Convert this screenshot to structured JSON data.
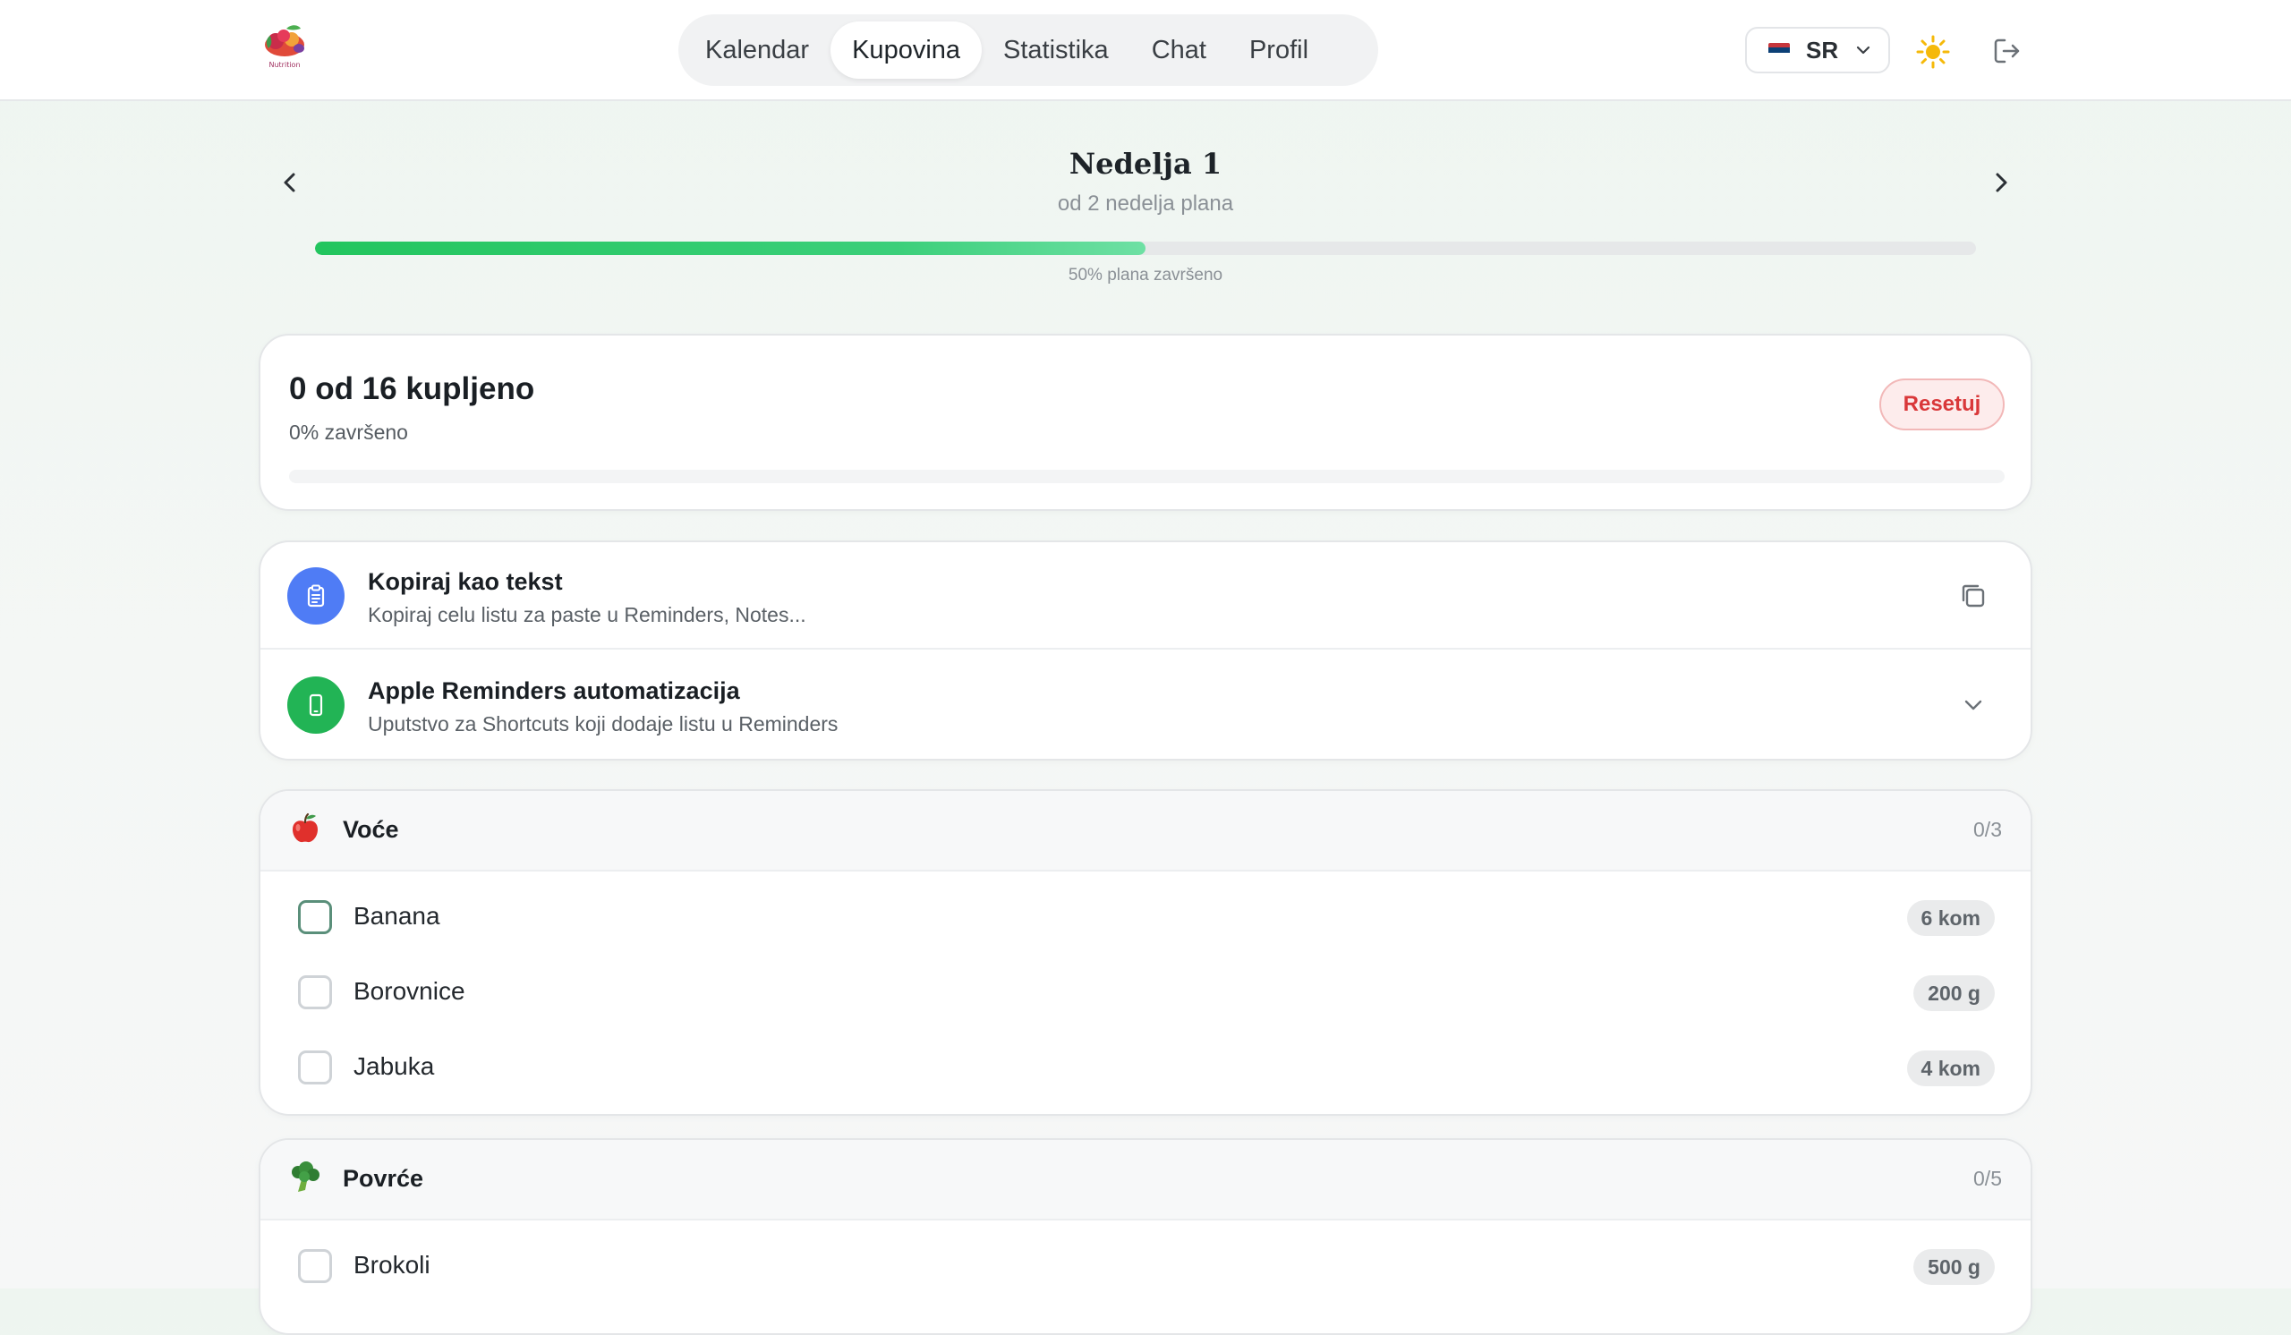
{
  "brand": {
    "logo_text": "Nutrition"
  },
  "nav": {
    "tabs": [
      {
        "label": "Kalendar",
        "active": false
      },
      {
        "label": "Kupovina",
        "active": true
      },
      {
        "label": "Statistika",
        "active": false
      },
      {
        "label": "Chat",
        "active": false
      },
      {
        "label": "Profil",
        "active": false
      }
    ]
  },
  "language": {
    "code": "SR",
    "flag_colors": [
      "#c6363c",
      "#0c4076",
      "#ffffff"
    ]
  },
  "icons": {
    "theme": "sun-icon",
    "logout": "logout-icon",
    "prev": "chevron-left-icon",
    "next": "chevron-right-icon"
  },
  "week": {
    "title": "Nedelja 1",
    "subtitle": "od 2 nedelja plana",
    "plan_progress_percent": 50,
    "plan_progress_label": "50% plana završeno"
  },
  "purchase": {
    "title": "0 od 16 kupljeno",
    "subtitle": "0% završeno",
    "progress_percent": 0,
    "reset_label": "Resetuj"
  },
  "actions": [
    {
      "title": "Kopiraj kao tekst",
      "description": "Kopiraj celu listu za paste u Reminders, Notes...",
      "icon": "clipboard-icon",
      "icon_color": "#4f7cf5",
      "right_icon": "copy-icon"
    },
    {
      "title": "Apple Reminders automatizacija",
      "description": "Uputstvo za Shortcuts koji dodaje listu u Reminders",
      "icon": "phone-icon",
      "icon_color": "#22b455",
      "right_icon": "chevron-down-icon"
    }
  ],
  "categories": [
    {
      "name": "Voće",
      "emoji": "apple-icon",
      "count": "0/3",
      "items": [
        {
          "name": "Banana",
          "qty": "6 kom"
        },
        {
          "name": "Borovnice",
          "qty": "200 g"
        },
        {
          "name": "Jabuka",
          "qty": "4 kom"
        }
      ]
    },
    {
      "name": "Povrće",
      "emoji": "broccoli-icon",
      "count": "0/5",
      "items": [
        {
          "name": "Brokoli",
          "qty": "500 g"
        }
      ]
    }
  ],
  "colors": {
    "accent_green": "#22c55e",
    "reset_red": "#d9383a"
  }
}
